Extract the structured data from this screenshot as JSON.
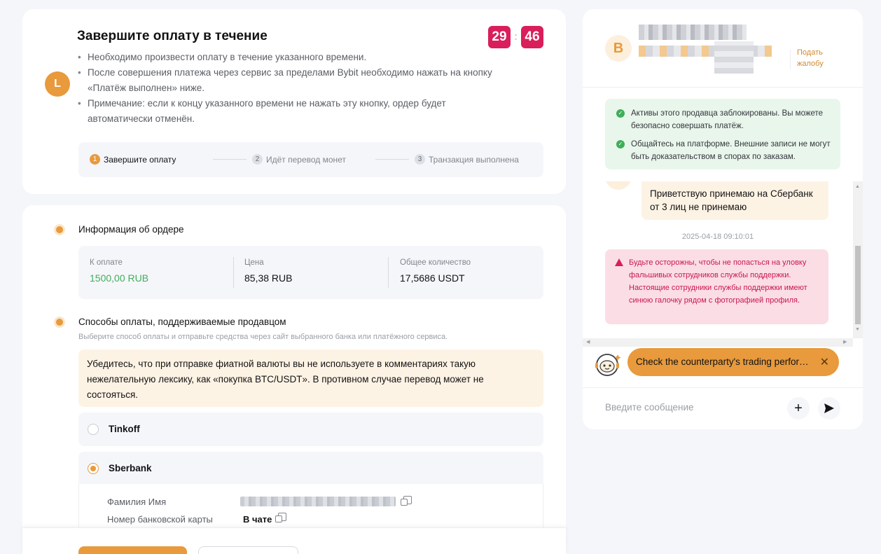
{
  "order": {
    "avatar_letter": "L",
    "title": "Завершите оплату в течение",
    "timer": {
      "minutes": "29",
      "separator": ":",
      "seconds": "46"
    },
    "bullets": [
      "Необходимо произвести оплату в течение указанного времени.",
      "После совершения платежа через сервис за пределами Bybit необходимо нажать на кнопку «Платёж выполнен» ниже.",
      "Примечание: если к концу указанного времени не нажать эту кнопку, ордер будет автоматически отменён."
    ],
    "steps": [
      {
        "num": "1",
        "label": "Завершите оплату"
      },
      {
        "num": "2",
        "label": "Идёт перевод монет"
      },
      {
        "num": "3",
        "label": "Транзакция выполнена"
      }
    ]
  },
  "info": {
    "title": "Информация об ордере",
    "pay_label": "К оплате",
    "pay_value": "1500,00 RUB",
    "price_label": "Цена",
    "price_value": "85,38 RUB",
    "qty_label": "Общее количество",
    "qty_value": "17,5686 USDT"
  },
  "methods": {
    "title": "Способы оплаты, поддерживаемые продавцом",
    "subtitle": "Выберите способ оплаты и отправьте средства через сайт выбранного банка или платёжного сервиса.",
    "warning": "Убедитесь, что при отправке фиатной валюты вы не используете в комментариях такую нежелательную лексику, как «покупка BTC/USDT». В противном случае перевод может не состояться.",
    "options": [
      {
        "name": "Tinkoff",
        "selected": false
      },
      {
        "name": "Sberbank",
        "selected": true
      }
    ],
    "details": {
      "name_label": "Фамилия Имя",
      "card_label": "Номер банковской карты",
      "card_value": "В чате"
    }
  },
  "chat": {
    "avatar_letter": "B",
    "complain_link": "Подать жалобу",
    "safe_notes": [
      "Активы этого продавца заблокированы. Вы можете безопасно совершать платёж.",
      "Общайтесь на платформе. Внешние записи не могут быть доказательством в спорах по заказам."
    ],
    "message": "Приветствую принемаю на Сбербанк от 3 лиц не принемаю",
    "timestamp": "2025-04-18 09:10:01",
    "alert": "Будьте осторожны, чтобы не попасться на уловку фальшивых сотрудников службы поддержки. Настоящие сотрудники службы поддержки имеют синюю галочку рядом с фотографией профиля.",
    "tip": "Check the counterparty's trading performance",
    "input_placeholder": "Введите сообщение"
  },
  "colors": {
    "accent": "#e89a3c",
    "timer": "#d91e5b",
    "success": "#3fae5a",
    "danger_text": "#c8174f"
  },
  "icons": {
    "check": "check-circle-icon",
    "alert": "warning-triangle-icon",
    "copy": "copy-icon",
    "plus": "plus-icon",
    "send": "send-icon",
    "close": "close-icon",
    "bot": "support-bot-icon"
  }
}
